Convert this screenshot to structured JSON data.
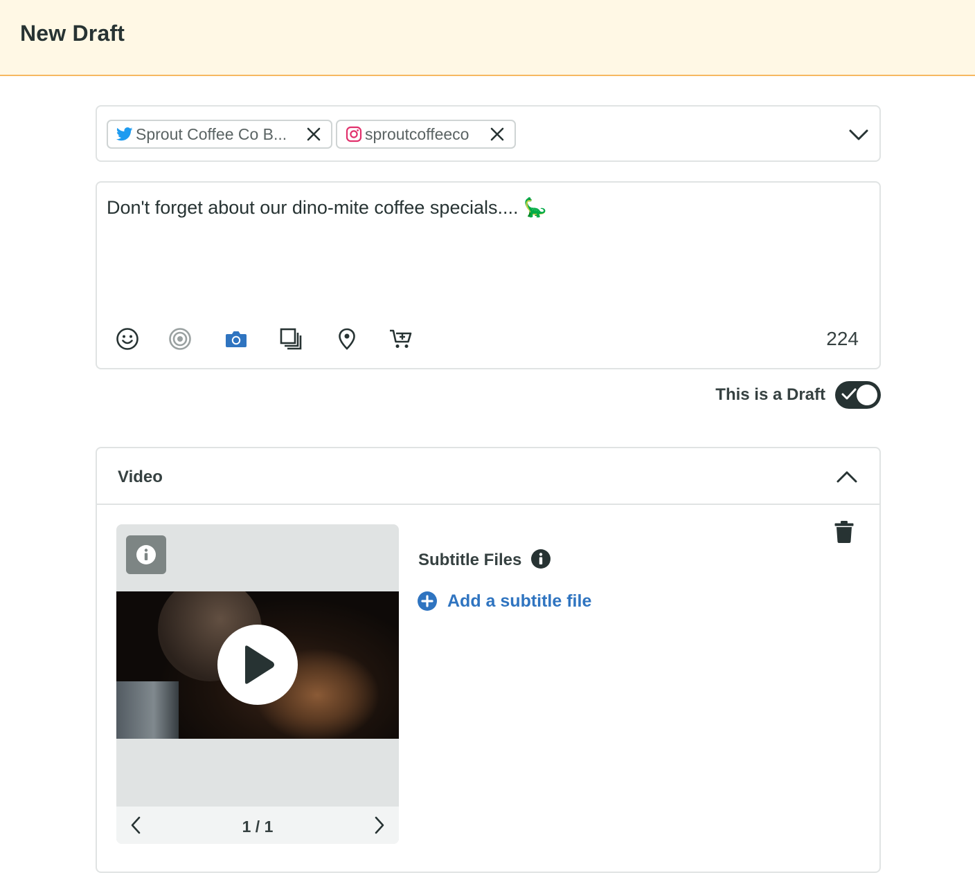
{
  "header": {
    "title": "New Draft"
  },
  "profiles": {
    "chips": [
      {
        "network": "twitter",
        "icon": "twitter-bird-icon",
        "label": "Sprout Coffee Co B..."
      },
      {
        "network": "instagram",
        "icon": "instagram-icon",
        "label": "sproutcoffeeco"
      }
    ],
    "dropdown_icon": "chevron-down-icon"
  },
  "composer": {
    "message": "Don't forget about our dino-mite coffee specials.... 🦕",
    "toolbar": [
      "emoji-icon",
      "target-icon",
      "camera-icon",
      "media-library-icon",
      "location-pin-icon",
      "shopping-cart-icon"
    ],
    "character_count": "224"
  },
  "draft": {
    "label": "This is a Draft",
    "enabled": true
  },
  "video_panel": {
    "title": "Video",
    "subtitle_files_label": "Subtitle Files",
    "add_subtitle_label": "Add a subtitle file",
    "pager": "1 / 1"
  },
  "colors": {
    "header_bg": "#fff8e5",
    "header_border": "#f6b860",
    "twitter": "#1d9bf0",
    "instagram": "#e1306c",
    "accent_blue": "#2f74c0",
    "dark": "#273333"
  }
}
